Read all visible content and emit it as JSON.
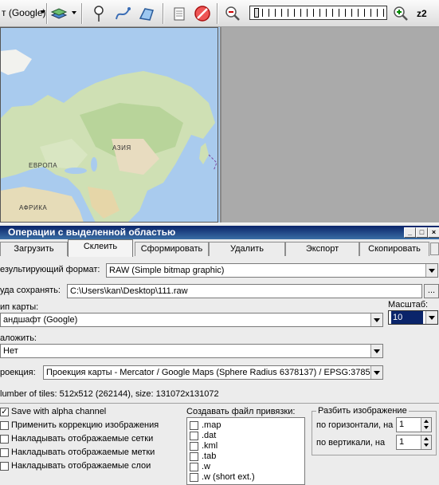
{
  "toolbar": {
    "map_source": "т (Google)",
    "zoom_label": "z2"
  },
  "map": {
    "labels": [
      "АЗИЯ",
      "ЕВРОПА",
      "АФРИКА"
    ]
  },
  "panel": {
    "title": "Операции с выделенной областью",
    "tabs": [
      {
        "label": "Загрузить",
        "active": false
      },
      {
        "label": "Склеить",
        "active": true
      },
      {
        "label": "Сформировать",
        "active": false
      },
      {
        "label": "Удалить",
        "active": false
      },
      {
        "label": "Экспорт",
        "active": false
      },
      {
        "label": "Скопировать",
        "active": false
      }
    ],
    "result_format_label": "езультирующий формат:",
    "result_format_value": "RAW (Simple bitmap graphic)",
    "save_to_label": "уда сохранять:",
    "save_to_value": "C:\\Users\\kan\\Desktop\\111.raw",
    "browse_label": "...",
    "map_type_label": "ип карты:",
    "map_type_value": "андшафт (Google)",
    "scale_label": "Масштаб:",
    "scale_value": "10",
    "overlay_label": "аложить:",
    "overlay_value": "Нет",
    "projection_label": "роекция:",
    "projection_value": "Проекция карты - Mercator / Google Maps (Sphere Radius 6378137) / EPSG:3785",
    "tiles_info": "lumber of tiles: 512x512 (262144), size: 131072x131072",
    "options": [
      {
        "label": "Save with alpha channel",
        "checked": true
      },
      {
        "label": "Применить коррекцию изображения",
        "checked": false
      },
      {
        "label": "Накладывать отображаемые сетки",
        "checked": false
      },
      {
        "label": "Накладывать отображаемые метки",
        "checked": false
      },
      {
        "label": "Накладывать отображаемые слои",
        "checked": false
      }
    ],
    "georef_label": "Создавать файл привязки:",
    "georef_files": [
      ".map",
      ".dat",
      ".kml",
      ".tab",
      ".w",
      ".w (short ext.)"
    ],
    "split_label": "Разбить изображение",
    "split_h_label": "по горизонтали, на",
    "split_h_value": "1",
    "split_v_label": "по вертикали, на",
    "split_v_value": "1"
  },
  "colors": {
    "titlebar_start": "#0a246a",
    "titlebar_end": "#3a6ea5",
    "selected_scale_bg": "#0a246a"
  }
}
